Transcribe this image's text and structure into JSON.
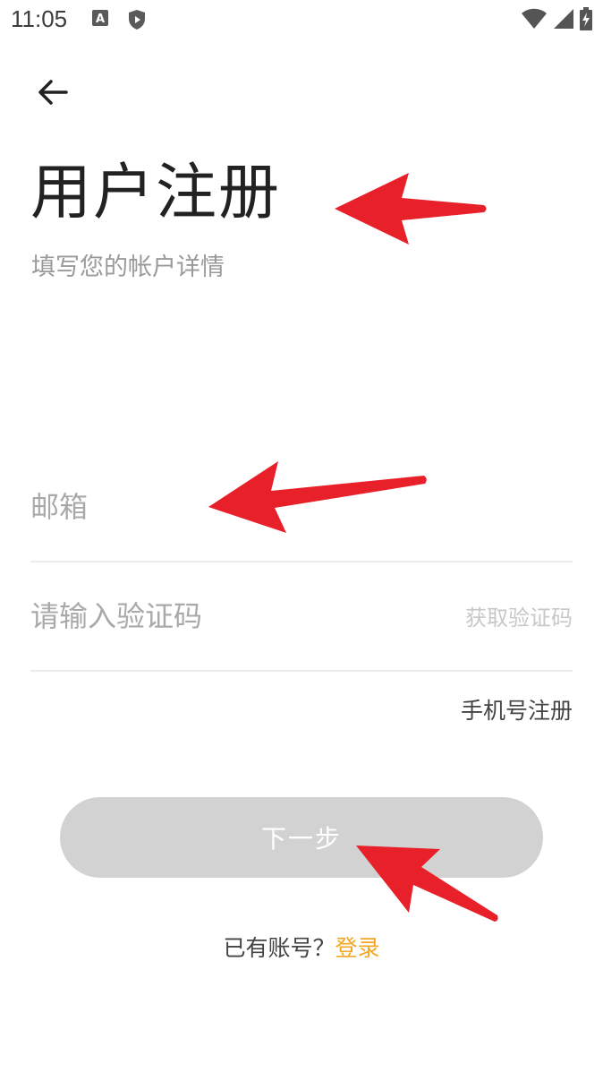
{
  "status_bar": {
    "time": "11:05",
    "left_icons": [
      "a-badge-icon",
      "shield-play-icon"
    ],
    "right_icons": [
      "wifi-icon",
      "signal-icon",
      "battery-charging-icon"
    ]
  },
  "header": {
    "back_icon": "arrow-left-icon",
    "title": "用户注册",
    "subtitle": "填写您的帐户详情"
  },
  "form": {
    "email": {
      "value": "",
      "placeholder": "邮箱"
    },
    "code": {
      "value": "",
      "placeholder": "请输入验证码",
      "get_code_label": "获取验证码"
    },
    "phone_register_label": "手机号注册",
    "next_label": "下一步"
  },
  "footer": {
    "has_account_text": "已有账号？",
    "login_label": "登录"
  },
  "colors": {
    "title": "#222222",
    "subtitle": "#9a9a9a",
    "accent": "#f5a623",
    "button_disabled": "#d2d2d2",
    "annotation_arrow": "#e8202a"
  }
}
